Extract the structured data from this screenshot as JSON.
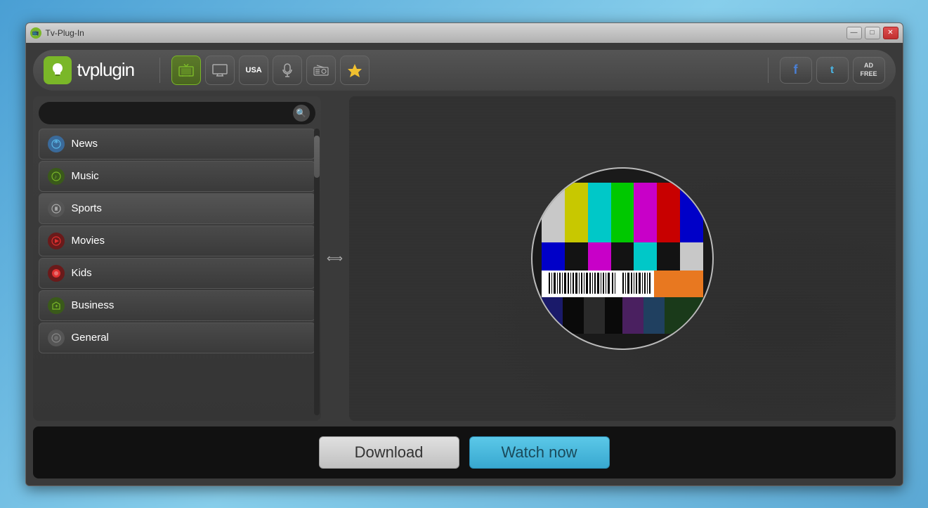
{
  "window": {
    "title": "Tv-Plug-In",
    "controls": {
      "minimize": "—",
      "maximize": "□",
      "close": "✕"
    }
  },
  "toolbar": {
    "logo_text": "tvplugin",
    "icons": [
      {
        "id": "tv-icon",
        "symbol": "📺",
        "active": true,
        "label": "TV"
      },
      {
        "id": "monitor-icon",
        "symbol": "🖥",
        "active": false,
        "label": "Monitor"
      },
      {
        "id": "usa-icon",
        "symbol": "USA",
        "active": false,
        "label": "USA"
      },
      {
        "id": "mic-icon",
        "symbol": "🎙",
        "active": false,
        "label": "Microphone"
      },
      {
        "id": "radio-icon",
        "symbol": "📻",
        "active": false,
        "label": "Radio"
      },
      {
        "id": "star-icon",
        "symbol": "★",
        "active": false,
        "label": "Favorites"
      }
    ],
    "social": [
      {
        "id": "facebook-btn",
        "label": "f",
        "type": "facebook"
      },
      {
        "id": "twitter-btn",
        "label": "t",
        "type": "twitter"
      },
      {
        "id": "adfree-btn",
        "label": "AD FREE",
        "type": "adfree"
      }
    ]
  },
  "sidebar": {
    "search_placeholder": "",
    "categories": [
      {
        "id": "news",
        "label": "News",
        "icon": "📡",
        "color": "#5a9fd4"
      },
      {
        "id": "music",
        "label": "Music",
        "icon": "🎵",
        "color": "#7ab728"
      },
      {
        "id": "sports",
        "label": "Sports",
        "icon": "⚙",
        "color": "#555"
      },
      {
        "id": "movies",
        "label": "Movies",
        "icon": "▶",
        "color": "#e03030"
      },
      {
        "id": "kids",
        "label": "Kids",
        "icon": "🔴",
        "color": "#e05050"
      },
      {
        "id": "business",
        "label": "Business",
        "icon": "✦",
        "color": "#7ab728"
      },
      {
        "id": "general",
        "label": "General",
        "icon": "📁",
        "color": "#888"
      }
    ]
  },
  "video": {
    "status": "no-signal",
    "test_card_visible": true
  },
  "bottom_bar": {
    "download_label": "Download",
    "watch_label": "Watch now"
  }
}
